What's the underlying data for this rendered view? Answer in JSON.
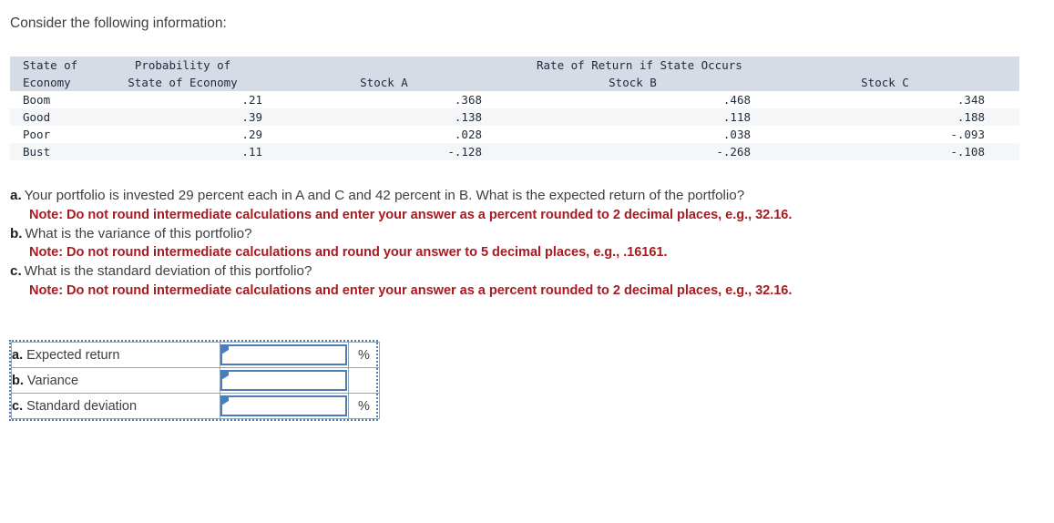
{
  "intro": "Consider the following information:",
  "table": {
    "headers": {
      "col1_line1": "State of",
      "col1_line2": "Economy",
      "col2_line1": "Probability of",
      "col2_line2": "State of Economy",
      "span_title": "Rate of Return if State Occurs",
      "stock_a": "Stock A",
      "stock_b": "Stock B",
      "stock_c": "Stock C"
    },
    "rows": [
      {
        "state": "Boom",
        "prob": ".21",
        "a": ".368",
        "b": ".468",
        "c": ".348"
      },
      {
        "state": "Good",
        "prob": ".39",
        "a": ".138",
        "b": ".118",
        "c": ".188"
      },
      {
        "state": "Poor",
        "prob": ".29",
        "a": ".028",
        "b": ".038",
        "c": "-.093"
      },
      {
        "state": "Bust",
        "prob": ".11",
        "a": "-.128",
        "b": "-.268",
        "c": "-.108"
      }
    ]
  },
  "questions": [
    {
      "marker": "a.",
      "text": "Your portfolio is invested 29 percent each in A and C and 42 percent in B. What is the expected return of the portfolio?",
      "note": "Note: Do not round intermediate calculations and enter your answer as a percent rounded to 2 decimal places, e.g., 32.16."
    },
    {
      "marker": "b.",
      "text": "What is the variance of this portfolio?",
      "note": "Note: Do not round intermediate calculations and round your answer to 5 decimal places, e.g., .16161."
    },
    {
      "marker": "c.",
      "text": "What is the standard deviation of this portfolio?",
      "note": "Note: Do not round intermediate calculations and enter your answer as a percent rounded to 2 decimal places, e.g., 32.16."
    }
  ],
  "answer_form": {
    "rows": [
      {
        "marker": "a.",
        "label": "Expected return",
        "value": "",
        "unit": "%"
      },
      {
        "marker": "b.",
        "label": "Variance",
        "value": "",
        "unit": ""
      },
      {
        "marker": "c.",
        "label": "Standard deviation",
        "value": "",
        "unit": "%"
      }
    ]
  },
  "colors": {
    "header_bg": "#d5dce6",
    "stripe_bg": "#f5f6f7",
    "note_red": "#a61c22",
    "input_blue": "#4a7ebb"
  }
}
